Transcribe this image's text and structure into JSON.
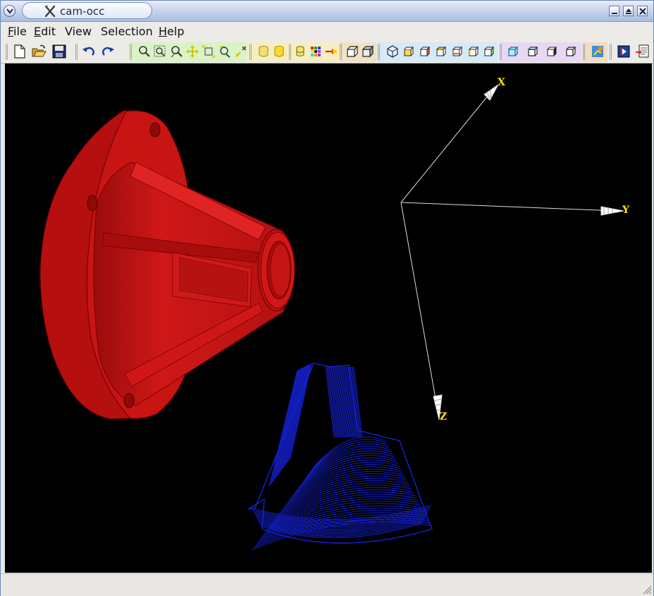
{
  "window": {
    "title": "cam-occ",
    "title_icon": "x-tool-icon",
    "controls": [
      "minimize-icon",
      "maximize-icon",
      "close-icon"
    ]
  },
  "menubar": {
    "items": [
      {
        "label": "File",
        "mnemonic": "F"
      },
      {
        "label": "Edit",
        "mnemonic": "E"
      },
      {
        "label": "View",
        "mnemonic": ""
      },
      {
        "label": "Selection",
        "mnemonic": ""
      },
      {
        "label": "Help",
        "mnemonic": "H"
      }
    ]
  },
  "toolbar": {
    "groups": [
      {
        "name": "file",
        "tint": "#ecebe8",
        "icons": [
          "new-file-icon",
          "open-folder-icon",
          "save-icon"
        ]
      },
      {
        "name": "history",
        "tint": "#ecebe8",
        "icons": [
          "undo-icon",
          "redo-icon"
        ]
      },
      {
        "name": "zoom",
        "tint": "#d9f3c6",
        "icons": [
          "zoom-icon",
          "zoom-window-icon",
          "zoom-dynamic-icon",
          "pan-icon",
          "fit-icon",
          "rotate-icon",
          "global-pan-icon"
        ]
      },
      {
        "name": "shading",
        "tint": "#f6eec0",
        "icons": [
          "cylinder-icon",
          "cylinder-shaded-icon",
          "cylinder-wire-icon",
          "color-grid-icon",
          "material-icon"
        ]
      },
      {
        "name": "display",
        "tint": "#f1e2c4",
        "icons": [
          "wireframe-icon",
          "shaded-icon"
        ]
      },
      {
        "name": "views",
        "tint": "#d6eaf6",
        "icons": [
          "axo-view-icon",
          "front-view-icon",
          "back-view-icon",
          "top-view-icon",
          "bottom-view-icon",
          "left-view-icon",
          "right-view-icon"
        ]
      },
      {
        "name": "selection",
        "tint": "#e8d8f3",
        "icons": [
          "select-vertex-icon",
          "select-edge-icon",
          "select-face-icon",
          "select-solid-icon"
        ]
      },
      {
        "name": "misc",
        "tint": "#f3dcc0",
        "icons": [
          "trihedron-icon"
        ]
      },
      {
        "name": "tools",
        "tint": "#ecebe8",
        "icons": [
          "export-icon",
          "document-icon"
        ]
      }
    ]
  },
  "viewport": {
    "background": "#000000",
    "part_color": "#c41414",
    "toolpath_color": "#1522d8",
    "trihedron": {
      "line_color": "#dcdcdc",
      "label_color": "#ffe600",
      "axes": [
        "X",
        "Y",
        "Z"
      ]
    }
  }
}
